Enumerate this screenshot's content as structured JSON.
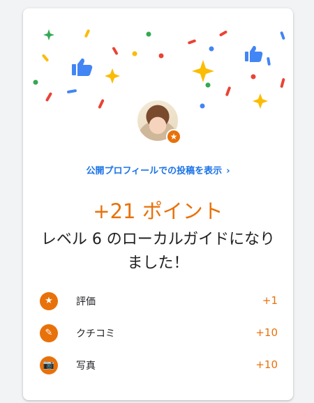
{
  "profile_link": {
    "label": "公開プロフィールでの投稿を表示",
    "chevron": "›"
  },
  "points_label": "+21 ポイント",
  "level_message": "レベル 6 のローカルガイドになりました！",
  "avatar_badge_icon": "star-icon",
  "colors": {
    "accent": "#e8710a",
    "link": "#1a73e8",
    "confetti": [
      "#4285f4",
      "#ea4335",
      "#fbbc04",
      "#34a853"
    ]
  },
  "rows": [
    {
      "icon": "star-icon",
      "glyph": "★",
      "label": "評価",
      "value": "+1"
    },
    {
      "icon": "review-edit-icon",
      "glyph": "✎",
      "label": "クチコミ",
      "value": "+10"
    },
    {
      "icon": "camera-icon",
      "glyph": "📷",
      "label": "写真",
      "value": "+10"
    }
  ]
}
